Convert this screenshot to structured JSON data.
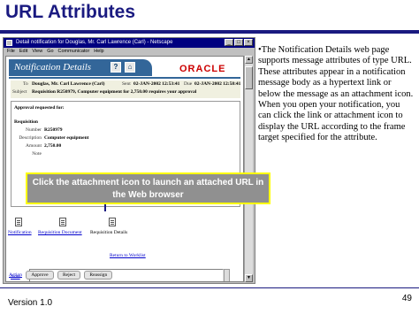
{
  "slide": {
    "title": "URL Attributes",
    "version": "Version 1.0",
    "page_number": "49"
  },
  "browser": {
    "window_title": "Detail notification for Douglas, Mr. Carl Lawrence (Carl) - Netscape",
    "menu": [
      "File",
      "Edit",
      "View",
      "Go",
      "Communicator",
      "Help"
    ]
  },
  "notification": {
    "header_title": "Notification Details",
    "help_icon_glyph": "?",
    "logo": "ORACLE",
    "to_label": "To",
    "to_value": "Douglas, Mr. Carl Lawrence (Carl)",
    "sent_label": "Sent",
    "sent_value": "02-JAN-2002 12:53:41",
    "due_label": "Due",
    "due_value": "02-JAN-2002 12:58:41",
    "subject_label": "Subject",
    "subject_value": "Requisition R250979, Computer equipment for 2,750.00 requires your approval",
    "body": {
      "heading": "Approval requested for:",
      "requisition": "Requisition",
      "fields": [
        {
          "key": "Number",
          "value": "R250979"
        },
        {
          "key": "Description",
          "value": "Computer equipment"
        },
        {
          "key": "Amount",
          "value": "2,750.00"
        },
        {
          "key": "Note",
          "value": ""
        }
      ]
    },
    "attachments": [
      "Notification",
      "Requisition Document",
      "Requisition Details"
    ],
    "return_link": "Return to Worklist",
    "note_label": "Note",
    "action_label": "Action",
    "actions": [
      "Approve",
      "Reject",
      "Reassign"
    ]
  },
  "callout": {
    "text": "Click the attachment icon to launch an attached URL in the Web browser"
  },
  "bullet": {
    "text": "•The Notification Details web page supports message attributes of type URL. These attributes appear in a notification message body as a hypertext link or below the message as an attachment icon. When you open your notification, you can click the link or attachment icon to display the URL according to the frame target specified for the attribute."
  }
}
